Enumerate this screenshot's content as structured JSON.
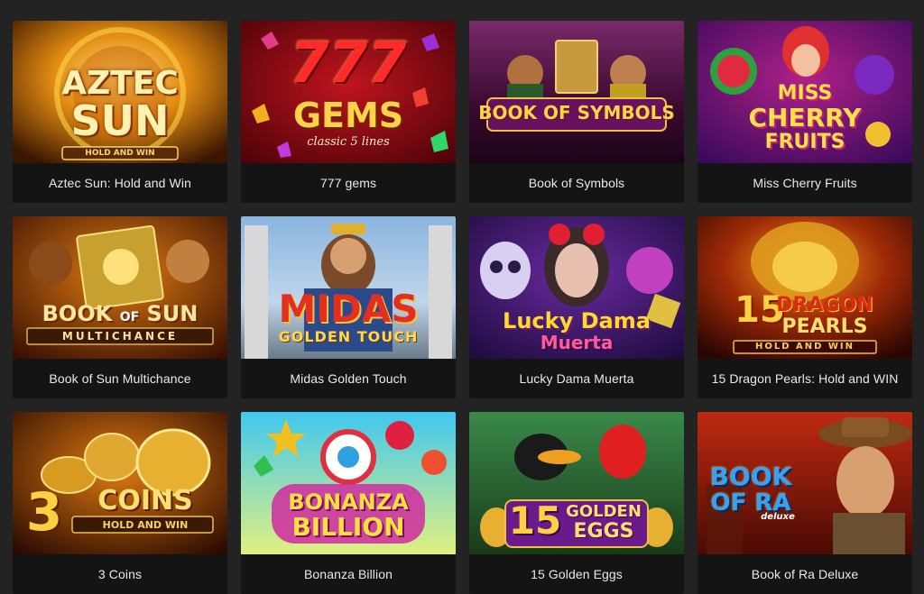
{
  "games": [
    {
      "title": "Aztec Sun: Hold and Win",
      "logo": [
        "AZTEC",
        "SUN"
      ],
      "tag": "HOLD AND WIN"
    },
    {
      "title": "777 gems",
      "logo": [
        "777",
        "GEMS"
      ],
      "tag": "classic 5 lines"
    },
    {
      "title": "Book of Symbols",
      "logo": [
        "BOOK OF SYMBOLS"
      ]
    },
    {
      "title": "Miss Cherry Fruits",
      "logo": [
        "MISS",
        "CHERRY",
        "FRUITS"
      ]
    },
    {
      "title": "Book of Sun Multichance",
      "logo": [
        "BOOK",
        "OF",
        "SUN"
      ],
      "tag": "MULTICHANCE"
    },
    {
      "title": "Midas Golden Touch",
      "logo": [
        "MIDAS"
      ],
      "tag": "GOLDEN TOUCH"
    },
    {
      "title": "Lucky Dama Muerta",
      "logo": [
        "Lucky Dama",
        "Muerta"
      ]
    },
    {
      "title": "15 Dragon Pearls: Hold and WIN",
      "logo": [
        "15",
        "DRAGON",
        "PEARLS"
      ],
      "tag": "HOLD AND WIN"
    },
    {
      "title": "3 Coins",
      "logo": [
        "3",
        "COINS"
      ],
      "tag": "HOLD AND WIN"
    },
    {
      "title": "Bonanza Billion",
      "logo": [
        "BONANZA",
        "BILLION"
      ]
    },
    {
      "title": "15 Golden Eggs",
      "logo": [
        "15",
        "GOLDEN",
        "EGGS"
      ]
    },
    {
      "title": "Book of Ra Deluxe",
      "logo": [
        "BOOK",
        "OF RA"
      ],
      "tag": "deluxe"
    }
  ]
}
